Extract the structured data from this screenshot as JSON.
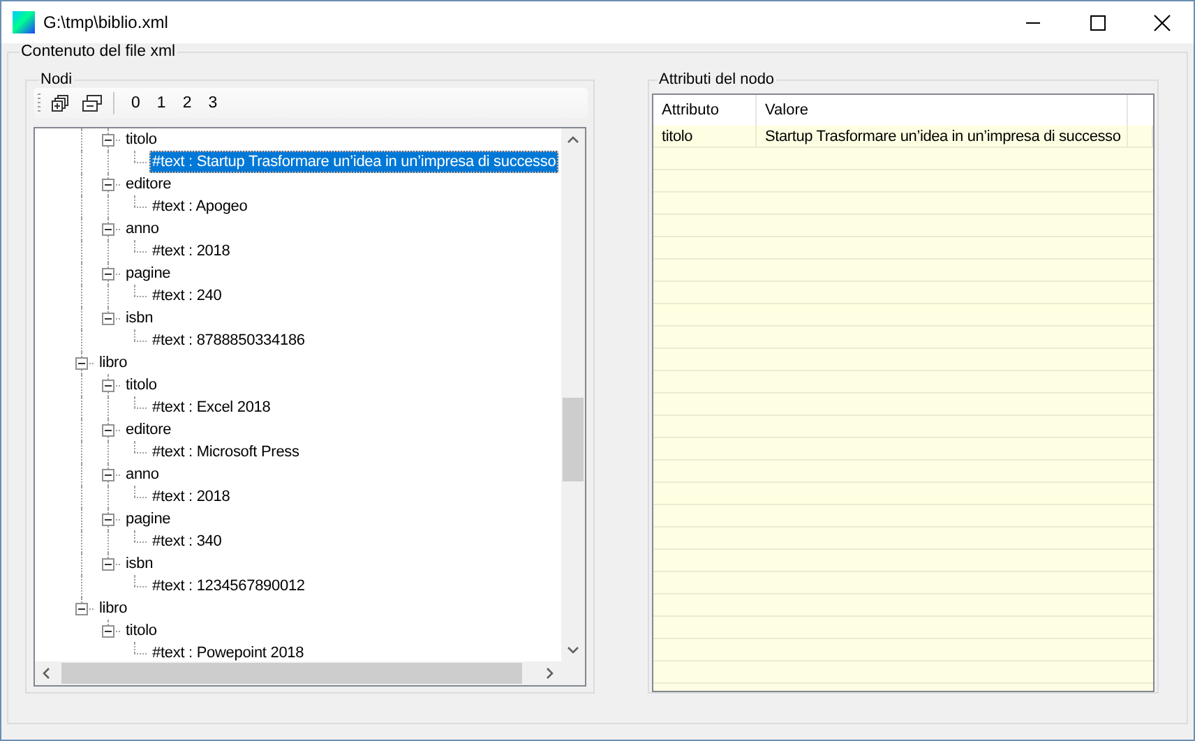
{
  "window": {
    "title": "G:\\tmp\\biblio.xml"
  },
  "content_group": {
    "title": "Contenuto del file xml"
  },
  "nodes_panel": {
    "title": "Nodi",
    "level_buttons": [
      "0",
      "1",
      "2",
      "3"
    ],
    "tree": [
      {
        "children": [
          {
            "label": "titolo",
            "expanded": true,
            "selected": false,
            "children": [
              {
                "label": "#text : Startup Trasformare un’idea in un’impresa di successo",
                "selected": true
              }
            ]
          },
          {
            "label": "editore",
            "expanded": true,
            "selected": false,
            "children": [
              {
                "label": "#text : Apogeo",
                "selected": false
              }
            ]
          },
          {
            "label": "anno",
            "expanded": true,
            "selected": false,
            "children": [
              {
                "label": "#text : 2018",
                "selected": false
              }
            ]
          },
          {
            "label": "pagine",
            "expanded": true,
            "selected": false,
            "children": [
              {
                "label": "#text : 240",
                "selected": false
              }
            ]
          },
          {
            "label": "isbn",
            "expanded": true,
            "selected": false,
            "children": [
              {
                "label": "#text : 8788850334186",
                "selected": false
              }
            ]
          }
        ]
      },
      {
        "label": "libro",
        "expanded": true,
        "selected": false,
        "children": [
          {
            "label": "titolo",
            "expanded": true,
            "selected": false,
            "children": [
              {
                "label": "#text : Excel 2018",
                "selected": false
              }
            ]
          },
          {
            "label": "editore",
            "expanded": true,
            "selected": false,
            "children": [
              {
                "label": "#text : Microsoft Press",
                "selected": false
              }
            ]
          },
          {
            "label": "anno",
            "expanded": true,
            "selected": false,
            "children": [
              {
                "label": "#text : 2018",
                "selected": false
              }
            ]
          },
          {
            "label": "pagine",
            "expanded": true,
            "selected": false,
            "children": [
              {
                "label": "#text : 340",
                "selected": false
              }
            ]
          },
          {
            "label": "isbn",
            "expanded": true,
            "selected": false,
            "children": [
              {
                "label": "#text : 1234567890012",
                "selected": false
              }
            ]
          }
        ]
      },
      {
        "label": "libro",
        "expanded": true,
        "selected": false,
        "children": [
          {
            "label": "titolo",
            "expanded": true,
            "selected": false,
            "children": [
              {
                "label": "#text : Powepoint 2018",
                "selected": false
              }
            ]
          }
        ]
      }
    ]
  },
  "attributes_panel": {
    "title": "Attributi del nodo",
    "columns": [
      "Attributo",
      "Valore"
    ],
    "rows": [
      {
        "cells": [
          "titolo",
          "Startup Trasformare un’idea in un’impresa di successo"
        ]
      }
    ]
  }
}
